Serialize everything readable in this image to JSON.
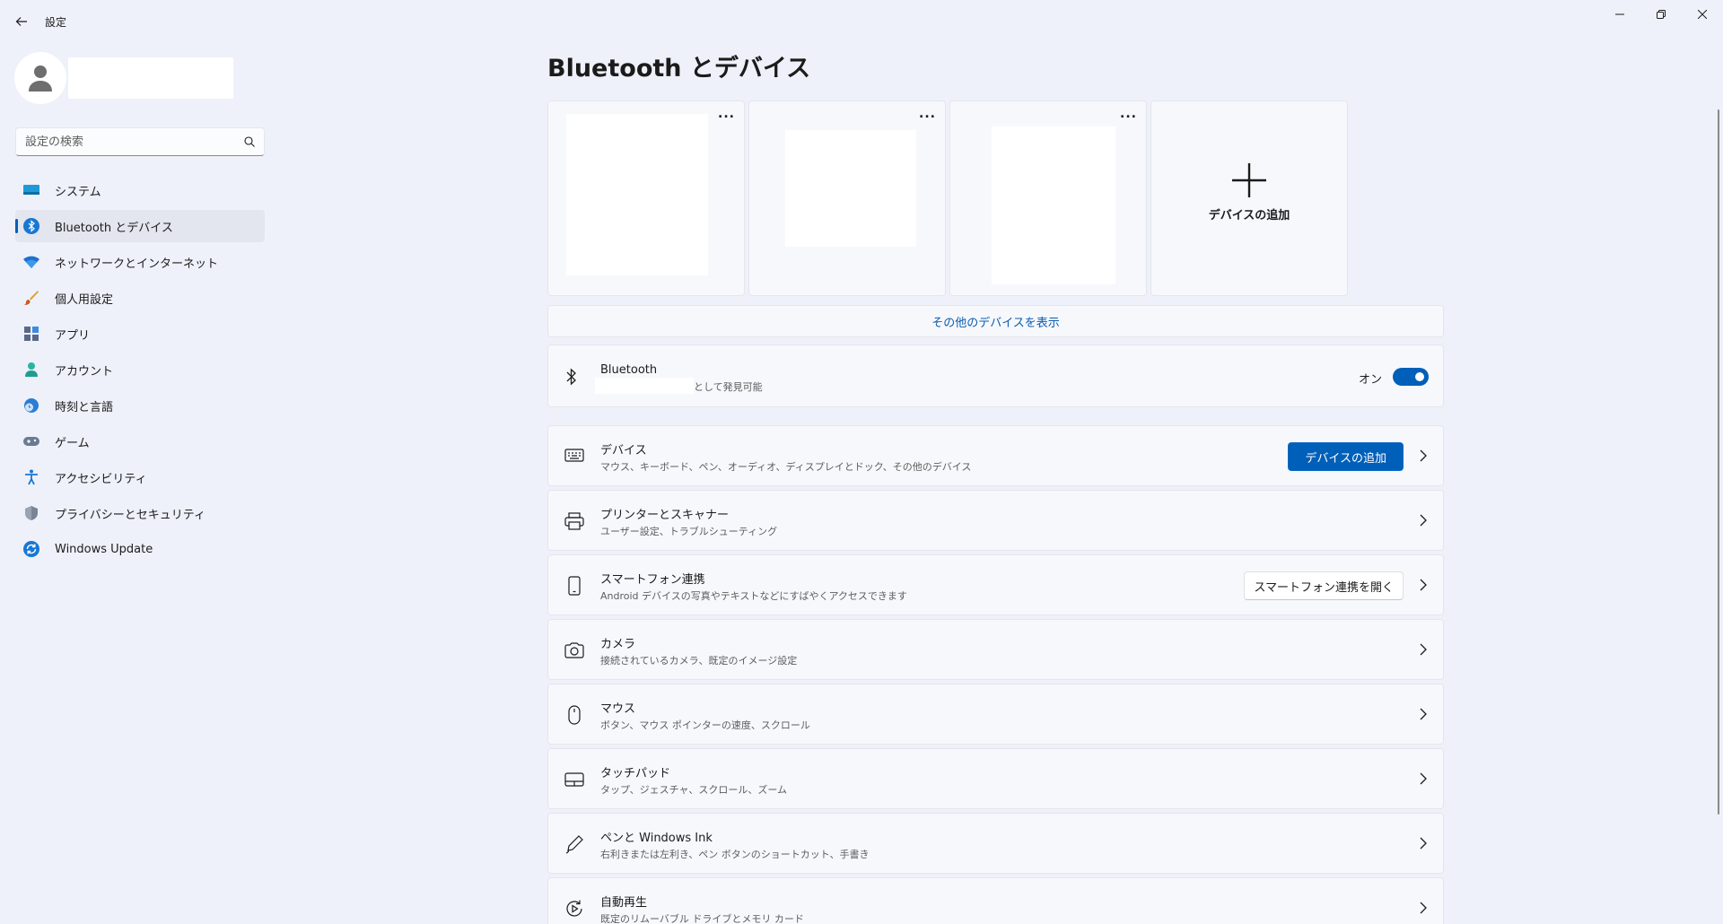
{
  "window": {
    "app_title": "設定",
    "back_icon": "back-arrow-icon",
    "controls": [
      "minimize-icon",
      "restore-icon",
      "close-icon"
    ]
  },
  "sidebar": {
    "search_placeholder": "設定の検索",
    "items": [
      {
        "label": "システム",
        "icon": "system-icon",
        "active": false
      },
      {
        "label": "Bluetooth とデバイス",
        "icon": "bluetooth-icon",
        "active": true
      },
      {
        "label": "ネットワークとインターネット",
        "icon": "wifi-icon",
        "active": false
      },
      {
        "label": "個人用設定",
        "icon": "brush-icon",
        "active": false
      },
      {
        "label": "アプリ",
        "icon": "apps-icon",
        "active": false
      },
      {
        "label": "アカウント",
        "icon": "account-icon",
        "active": false
      },
      {
        "label": "時刻と言語",
        "icon": "time-language-icon",
        "active": false
      },
      {
        "label": "ゲーム",
        "icon": "gamepad-icon",
        "active": false
      },
      {
        "label": "アクセシビリティ",
        "icon": "accessibility-icon",
        "active": false
      },
      {
        "label": "プライバシーとセキュリティ",
        "icon": "shield-icon",
        "active": false
      },
      {
        "label": "Windows Update",
        "icon": "windows-update-icon",
        "active": false
      }
    ]
  },
  "main": {
    "title": "Bluetooth とデバイス",
    "tiles": {
      "more_label": "...",
      "add_device_label": "デバイスの追加"
    },
    "show_more_label": "その他のデバイスを表示",
    "bluetooth": {
      "title": "Bluetooth",
      "discoverable_suffix": "として発見可能",
      "state_label": "オン",
      "enabled": true
    },
    "rows": [
      {
        "title": "デバイス",
        "subtitle": "マウス、キーボード、ペン、オーディオ、ディスプレイとドック、その他のデバイス",
        "icon": "devices-icon",
        "button": "デバイスの追加"
      },
      {
        "title": "プリンターとスキャナー",
        "subtitle": "ユーザー設定、トラブルシューティング",
        "icon": "printer-icon"
      },
      {
        "title": "スマートフォン連携",
        "subtitle": "Android デバイスの写真やテキストなどにすばやくアクセスできます",
        "icon": "phone-icon",
        "button": "スマートフォン連携を開く"
      },
      {
        "title": "カメラ",
        "subtitle": "接続されているカメラ、既定のイメージ設定",
        "icon": "camera-icon"
      },
      {
        "title": "マウス",
        "subtitle": "ボタン、マウス ポインターの速度、スクロール",
        "icon": "mouse-icon"
      },
      {
        "title": "タッチパッド",
        "subtitle": "タップ、ジェスチャ、スクロール、ズーム",
        "icon": "touchpad-icon"
      },
      {
        "title": "ペンと Windows Ink",
        "subtitle": "右利きまたは左利き、ペン ボタンのショートカット、手書き",
        "icon": "pen-icon"
      },
      {
        "title": "自動再生",
        "subtitle": "既定のリムーバブル ドライブとメモリ カード",
        "icon": "autoplay-icon"
      }
    ]
  }
}
